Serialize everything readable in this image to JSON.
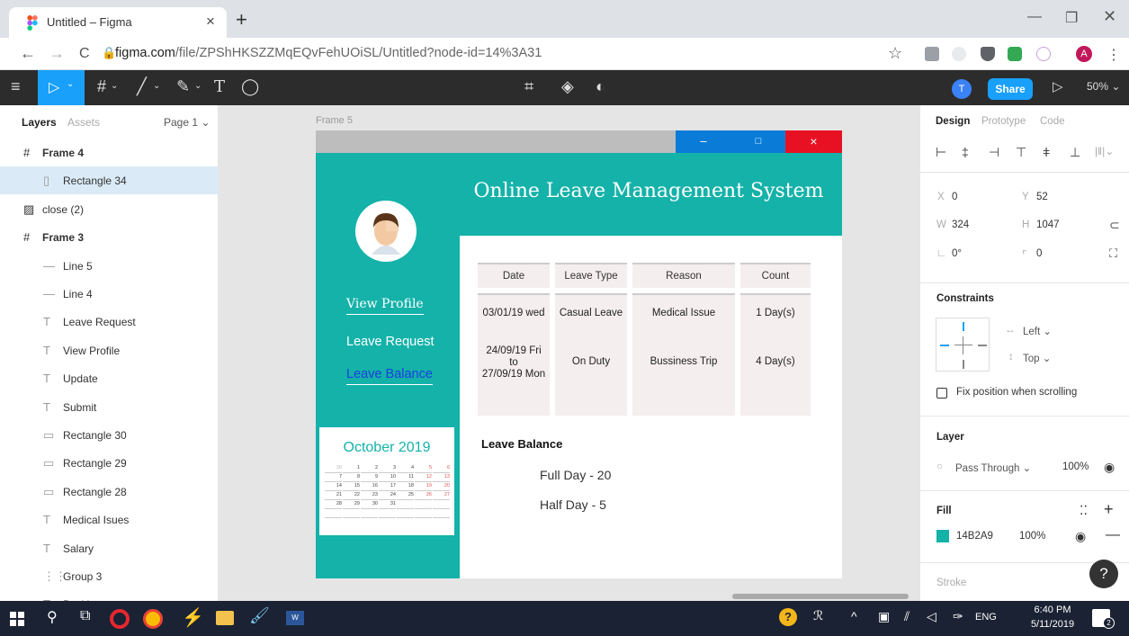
{
  "browser": {
    "tab_title": "Untitled – Figma",
    "tab_close": "×",
    "new_tab": "+",
    "url_domain": "figma.com",
    "url_path": "/file/ZPShHKSZZMqEQvFehUOiSL/Untitled?node-id=14%3A31",
    "back": "←",
    "forward": "→",
    "reload": "C",
    "star": "☆",
    "profile_initial": "A"
  },
  "figma_toolbar": {
    "user_initial": "T",
    "share_label": "Share",
    "zoom": "50% ⌄"
  },
  "layers_panel": {
    "tab_layers": "Layers",
    "tab_assets": "Assets",
    "page_selector": "Page 1 ⌄",
    "items": [
      {
        "icon": "#",
        "label": "Frame 4",
        "indent": 0,
        "bold": true,
        "selected": false
      },
      {
        "icon": "▯",
        "label": "Rectangle 34",
        "indent": 1,
        "bold": false,
        "selected": true
      },
      {
        "icon": "▨",
        "label": "close (2)",
        "indent": 0,
        "bold": false,
        "selected": false
      },
      {
        "icon": "#",
        "label": "Frame 3",
        "indent": 0,
        "bold": true,
        "selected": false
      },
      {
        "icon": "—",
        "label": "Line 5",
        "indent": 1,
        "bold": false,
        "selected": false
      },
      {
        "icon": "—",
        "label": "Line 4",
        "indent": 1,
        "bold": false,
        "selected": false
      },
      {
        "icon": "T",
        "label": "Leave Request",
        "indent": 1,
        "bold": false,
        "selected": false
      },
      {
        "icon": "T",
        "label": "View Profile",
        "indent": 1,
        "bold": false,
        "selected": false
      },
      {
        "icon": "T",
        "label": "Update",
        "indent": 1,
        "bold": false,
        "selected": false
      },
      {
        "icon": "T",
        "label": "Submit",
        "indent": 1,
        "bold": false,
        "selected": false
      },
      {
        "icon": "▭",
        "label": "Rectangle 30",
        "indent": 1,
        "bold": false,
        "selected": false
      },
      {
        "icon": "▭",
        "label": "Rectangle 29",
        "indent": 1,
        "bold": false,
        "selected": false
      },
      {
        "icon": "▭",
        "label": "Rectangle 28",
        "indent": 1,
        "bold": false,
        "selected": false
      },
      {
        "icon": "T",
        "label": "Medical Isues",
        "indent": 1,
        "bold": false,
        "selected": false
      },
      {
        "icon": "T",
        "label": "Salary",
        "indent": 1,
        "bold": false,
        "selected": false
      },
      {
        "icon": "⋮⋮",
        "label": "Group 3",
        "indent": 1,
        "bold": false,
        "selected": false
      },
      {
        "icon": "T",
        "label": "Position",
        "indent": 1,
        "bold": false,
        "selected": false
      }
    ]
  },
  "canvas": {
    "frame_label": "Frame 5",
    "window_controls": {
      "minimize": "–",
      "maximize": "□",
      "close": "×"
    },
    "app_title": "Online Leave Management System",
    "nav": {
      "view_profile": "View Profile",
      "leave_request": "Leave Request",
      "leave_balance": "Leave Balance"
    },
    "calendar": {
      "month": "October 2019",
      "rows": [
        [
          "30",
          "1",
          "2",
          "3",
          "4",
          "5",
          "6"
        ],
        [
          "7",
          "8",
          "9",
          "10",
          "11",
          "12",
          "13"
        ],
        [
          "14",
          "15",
          "16",
          "17",
          "18",
          "19",
          "20"
        ],
        [
          "21",
          "22",
          "23",
          "24",
          "25",
          "26",
          "27"
        ],
        [
          "28",
          "29",
          "30",
          "31",
          "",
          "",
          ""
        ],
        [
          "",
          "",
          "",
          "",
          "",
          "",
          ""
        ]
      ]
    },
    "table": {
      "headers": [
        "Date",
        "Leave Type",
        "Reason",
        "Count"
      ],
      "rows": [
        [
          "03/01/19 wed",
          "Casual Leave",
          "Medical Issue",
          "1 Day(s)"
        ],
        [
          "24/09/19 Fri\nto\n27/09/19 Mon",
          "On Duty",
          "Bussiness Trip",
          "4 Day(s)"
        ]
      ]
    },
    "leave_balance": {
      "heading": "Leave Balance",
      "full_day": "Full Day  - 20",
      "half_day": "Half Day  - 5"
    }
  },
  "properties_panel": {
    "tab_design": "Design",
    "tab_prototype": "Prototype",
    "tab_code": "Code",
    "x_label": "X",
    "x_value": "0",
    "y_label": "Y",
    "y_value": "52",
    "w_label": "W",
    "w_value": "324",
    "h_label": "H",
    "h_value": "1047",
    "rotation": "0°",
    "radius": "0",
    "constraints_title": "Constraints",
    "constraint_h": "Left ⌄",
    "constraint_v": "Top ⌄",
    "fix_position": "Fix position when scrolling",
    "layer_title": "Layer",
    "blend_mode": "Pass Through ⌄",
    "layer_opacity": "100%",
    "fill_title": "Fill",
    "fill_hex": "14B2A9",
    "fill_opacity": "100%",
    "stroke_title": "Stroke",
    "help": "?"
  },
  "taskbar": {
    "lang": "ENG",
    "time": "6:40 PM",
    "date": "5/11/2019",
    "notif_count": "2"
  },
  "colors": {
    "teal": "#14B2A9",
    "figma_dark": "#2c2c2c",
    "figma_blue": "#18a0fb",
    "close_red": "#e81123",
    "min_blue": "#0a7cd8"
  }
}
